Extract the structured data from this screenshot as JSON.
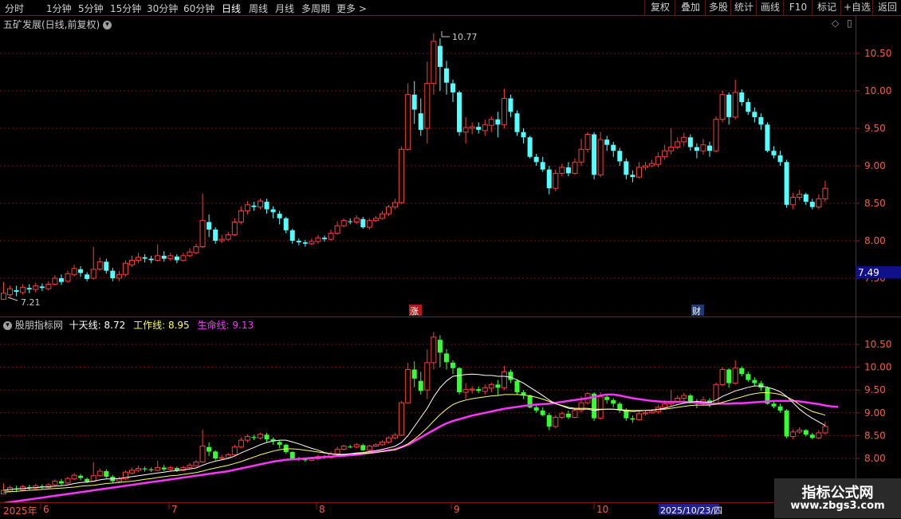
{
  "toolbar": {
    "timeframes": [
      "分时",
      "1分钟",
      "5分钟",
      "15分钟",
      "30分钟",
      "60分钟",
      "日线",
      "周线",
      "月线",
      "多周期",
      "更多"
    ],
    "active_timeframe": "日线",
    "more_arrow": ">",
    "buttons": [
      "复权",
      "叠加",
      "多股",
      "统计",
      "画线",
      "F10",
      "标记",
      "+自选",
      "返回"
    ]
  },
  "main_chart": {
    "title": "五矿发展(日线,前复权)",
    "right_icons": [
      "◇",
      "▯"
    ],
    "price_labels": [
      "10.50",
      "10.00",
      "9.50",
      "9.00",
      "8.50",
      "8.00",
      "7.50"
    ],
    "high_marker": "10.77",
    "low_marker": "7.21",
    "current_price_label": "7.49",
    "markers": [
      "涨",
      "财"
    ]
  },
  "sub_chart": {
    "title": "股朋指标网",
    "line1_label": "十天线:",
    "line1_value": "8.72",
    "line2_label": "工作线:",
    "line2_value": "8.95",
    "line3_label": "生命线:",
    "line3_value": "9.13",
    "price_labels": [
      "10.50",
      "10.00",
      "9.50",
      "9.00",
      "8.50",
      "8.00"
    ]
  },
  "time_axis": {
    "labels": [
      "2025年",
      "6",
      "7",
      "8",
      "9",
      "10"
    ],
    "highlighted_date": "2025/10/23/四"
  },
  "watermark": {
    "line1": "指标公式网",
    "line2": "www.zbgs3.com"
  },
  "colors": {
    "up": "#ff3b3b",
    "down_main": "#54ffff",
    "down_sub": "#33ff33",
    "ten_line": "#ffffff",
    "work_line": "#ffff66",
    "life_line": "#ff33ff",
    "grid": "#7a1010"
  },
  "chart_data": {
    "type": "candlestick",
    "candles": [
      [
        7.22,
        7.3,
        7.45,
        7.21
      ],
      [
        7.28,
        7.36,
        7.4,
        7.25
      ],
      [
        7.34,
        7.32,
        7.4,
        7.26
      ],
      [
        7.31,
        7.38,
        7.42,
        7.28
      ],
      [
        7.37,
        7.35,
        7.42,
        7.3
      ],
      [
        7.35,
        7.4,
        7.44,
        7.31
      ],
      [
        7.39,
        7.37,
        7.43,
        7.33
      ],
      [
        7.36,
        7.42,
        7.46,
        7.34
      ],
      [
        7.42,
        7.5,
        7.54,
        7.4
      ],
      [
        7.5,
        7.45,
        7.55,
        7.41
      ],
      [
        7.46,
        7.56,
        7.6,
        7.44
      ],
      [
        7.55,
        7.63,
        7.68,
        7.52
      ],
      [
        7.62,
        7.57,
        7.66,
        7.52
      ],
      [
        7.55,
        7.49,
        7.58,
        7.46
      ],
      [
        7.5,
        7.62,
        7.92,
        7.48
      ],
      [
        7.62,
        7.72,
        7.78,
        7.6
      ],
      [
        7.72,
        7.6,
        7.76,
        7.56
      ],
      [
        7.6,
        7.5,
        7.64,
        7.46
      ],
      [
        7.5,
        7.55,
        7.6,
        7.46
      ],
      [
        7.55,
        7.7,
        7.74,
        7.52
      ],
      [
        7.68,
        7.74,
        7.8,
        7.65
      ],
      [
        7.74,
        7.78,
        7.84,
        7.7
      ],
      [
        7.78,
        7.76,
        7.82,
        7.71
      ],
      [
        7.76,
        7.74,
        7.8,
        7.7
      ],
      [
        7.74,
        7.8,
        7.95,
        7.72
      ],
      [
        7.8,
        7.76,
        7.86,
        7.72
      ],
      [
        7.76,
        7.8,
        7.84,
        7.73
      ],
      [
        7.79,
        7.74,
        7.82,
        7.7
      ],
      [
        7.74,
        7.8,
        7.84,
        7.72
      ],
      [
        7.8,
        7.85,
        7.9,
        7.78
      ],
      [
        7.84,
        7.92,
        7.96,
        7.82
      ],
      [
        7.92,
        8.27,
        8.63,
        7.9
      ],
      [
        8.25,
        8.15,
        8.35,
        8.05
      ],
      [
        8.15,
        8.0,
        8.18,
        7.96
      ],
      [
        8.0,
        8.02,
        8.08,
        7.97
      ],
      [
        8.02,
        8.08,
        8.12,
        8.0
      ],
      [
        8.08,
        8.25,
        8.3,
        8.06
      ],
      [
        8.25,
        8.4,
        8.46,
        8.22
      ],
      [
        8.4,
        8.48,
        8.53,
        8.35
      ],
      [
        8.47,
        8.45,
        8.52,
        8.4
      ],
      [
        8.45,
        8.53,
        8.56,
        8.42
      ],
      [
        8.52,
        8.42,
        8.56,
        8.36
      ],
      [
        8.42,
        8.38,
        8.46,
        8.3
      ],
      [
        8.36,
        8.3,
        8.4,
        8.22
      ],
      [
        8.3,
        8.14,
        8.32,
        8.1
      ],
      [
        8.14,
        8.0,
        8.16,
        7.96
      ],
      [
        8.0,
        7.98,
        8.03,
        7.94
      ],
      [
        7.98,
        7.96,
        8.01,
        7.92
      ],
      [
        7.96,
        7.99,
        8.03,
        7.94
      ],
      [
        7.99,
        8.04,
        8.08,
        7.96
      ],
      [
        8.04,
        8.02,
        8.07,
        7.99
      ],
      [
        8.02,
        8.1,
        8.15,
        8.0
      ],
      [
        8.1,
        8.2,
        8.26,
        8.08
      ],
      [
        8.2,
        8.27,
        8.3,
        8.18
      ],
      [
        8.26,
        8.25,
        8.3,
        8.22
      ],
      [
        8.25,
        8.3,
        8.34,
        8.22
      ],
      [
        8.29,
        8.18,
        8.32,
        8.16
      ],
      [
        8.18,
        8.27,
        8.3,
        8.15
      ],
      [
        8.27,
        8.3,
        8.33,
        8.25
      ],
      [
        8.3,
        8.36,
        8.4,
        8.28
      ],
      [
        8.36,
        8.45,
        8.48,
        8.33
      ],
      [
        8.45,
        8.51,
        8.56,
        8.42
      ],
      [
        8.51,
        9.22,
        9.26,
        8.49
      ],
      [
        9.22,
        9.95,
        10.1,
        9.2
      ],
      [
        9.95,
        9.75,
        10.13,
        9.56
      ],
      [
        9.7,
        9.48,
        9.9,
        9.4
      ],
      [
        9.5,
        10.1,
        10.39,
        9.3
      ],
      [
        10.1,
        10.66,
        10.77,
        9.95
      ],
      [
        10.6,
        10.32,
        10.7,
        10.0
      ],
      [
        10.3,
        10.11,
        10.4,
        9.95
      ],
      [
        10.1,
        9.98,
        10.15,
        9.85
      ],
      [
        9.98,
        9.45,
        10.0,
        9.4
      ],
      [
        9.45,
        9.51,
        9.65,
        9.3
      ],
      [
        9.5,
        9.52,
        9.58,
        9.42
      ],
      [
        9.52,
        9.48,
        9.58,
        9.43
      ],
      [
        9.47,
        9.55,
        9.62,
        9.4
      ],
      [
        9.54,
        9.62,
        9.66,
        9.45
      ],
      [
        9.62,
        9.55,
        9.72,
        9.38
      ],
      [
        9.55,
        9.9,
        10.03,
        9.5
      ],
      [
        9.9,
        9.72,
        9.95,
        9.65
      ],
      [
        9.7,
        9.45,
        9.74,
        9.4
      ],
      [
        9.45,
        9.38,
        9.5,
        9.3
      ],
      [
        9.38,
        9.12,
        9.4,
        9.1
      ],
      [
        9.12,
        9.05,
        9.16,
        9.0
      ],
      [
        9.05,
        8.95,
        9.12,
        8.92
      ],
      [
        8.95,
        8.7,
        9.0,
        8.62
      ],
      [
        8.7,
        8.9,
        8.95,
        8.66
      ],
      [
        8.9,
        8.98,
        9.03,
        8.86
      ],
      [
        8.98,
        8.9,
        9.05,
        8.86
      ],
      [
        8.9,
        9.05,
        9.1,
        8.88
      ],
      [
        9.05,
        9.22,
        9.36,
        9.0
      ],
      [
        9.22,
        9.42,
        9.45,
        9.18
      ],
      [
        9.42,
        8.88,
        9.45,
        8.82
      ],
      [
        8.88,
        9.35,
        9.45,
        8.85
      ],
      [
        9.35,
        9.28,
        9.4,
        9.2
      ],
      [
        9.28,
        9.2,
        9.32,
        9.12
      ],
      [
        9.2,
        9.06,
        9.24,
        9.0
      ],
      [
        9.06,
        8.88,
        9.1,
        8.82
      ],
      [
        8.88,
        8.85,
        8.94,
        8.78
      ],
      [
        8.85,
        8.98,
        9.05,
        8.83
      ],
      [
        8.98,
        9.0,
        9.05,
        8.94
      ],
      [
        9.0,
        9.03,
        9.08,
        8.98
      ],
      [
        9.02,
        9.12,
        9.18,
        8.98
      ],
      [
        9.12,
        9.2,
        9.28,
        9.08
      ],
      [
        9.2,
        9.25,
        9.5,
        9.15
      ],
      [
        9.25,
        9.32,
        9.38,
        9.22
      ],
      [
        9.32,
        9.38,
        9.44,
        9.26
      ],
      [
        9.38,
        9.25,
        9.42,
        9.2
      ],
      [
        9.25,
        9.2,
        9.3,
        9.1
      ],
      [
        9.2,
        9.28,
        9.36,
        9.15
      ],
      [
        9.27,
        9.2,
        9.32,
        9.12
      ],
      [
        9.2,
        9.62,
        9.66,
        9.18
      ],
      [
        9.62,
        9.95,
        10.0,
        9.58
      ],
      [
        9.95,
        9.65,
        9.98,
        9.55
      ],
      [
        9.65,
        9.98,
        10.15,
        9.62
      ],
      [
        9.98,
        9.85,
        10.02,
        9.8
      ],
      [
        9.85,
        9.72,
        9.9,
        9.68
      ],
      [
        9.72,
        9.65,
        9.78,
        9.58
      ],
      [
        9.65,
        9.55,
        9.7,
        9.48
      ],
      [
        9.55,
        9.2,
        9.58,
        9.18
      ],
      [
        9.2,
        9.14,
        9.26,
        9.1
      ],
      [
        9.14,
        9.05,
        9.2,
        9.0
      ],
      [
        9.05,
        8.48,
        9.08,
        8.44
      ],
      [
        8.48,
        8.58,
        8.64,
        8.42
      ],
      [
        8.58,
        8.62,
        8.68,
        8.54
      ],
      [
        8.62,
        8.52,
        8.64,
        8.48
      ],
      [
        8.52,
        8.45,
        8.56,
        8.42
      ],
      [
        8.45,
        8.56,
        8.62,
        8.42
      ],
      [
        8.56,
        8.7,
        8.8,
        8.52
      ]
    ],
    "ten_line": [
      7.3,
      7.32,
      7.33,
      7.34,
      7.35,
      7.36,
      7.37,
      7.38,
      7.39,
      7.4,
      7.42,
      7.45,
      7.47,
      7.48,
      7.5,
      7.53,
      7.55,
      7.55,
      7.56,
      7.58,
      7.6,
      7.62,
      7.64,
      7.66,
      7.68,
      7.7,
      7.72,
      7.73,
      7.75,
      7.77,
      7.79,
      7.85,
      7.9,
      7.94,
      7.97,
      8.0,
      8.05,
      8.12,
      8.18,
      8.24,
      8.3,
      8.35,
      8.38,
      8.4,
      8.4,
      8.36,
      8.32,
      8.27,
      8.22,
      8.18,
      8.13,
      8.1,
      8.08,
      8.08,
      8.1,
      8.12,
      8.13,
      8.15,
      8.17,
      8.2,
      8.23,
      8.27,
      8.35,
      8.5,
      8.7,
      8.9,
      9.1,
      9.35,
      9.55,
      9.7,
      9.8,
      9.82,
      9.84,
      9.85,
      9.84,
      9.82,
      9.82,
      9.8,
      9.8,
      9.78,
      9.72,
      9.65,
      9.56,
      9.47,
      9.38,
      9.28,
      9.2,
      9.15,
      9.1,
      9.08,
      9.08,
      9.08,
      9.05,
      9.07,
      9.08,
      9.08,
      9.06,
      9.04,
      9.03,
      9.04,
      9.05,
      9.06,
      9.08,
      9.1,
      9.14,
      9.18,
      9.21,
      9.24,
      9.25,
      9.24,
      9.23,
      9.28,
      9.36,
      9.42,
      9.48,
      9.52,
      9.56,
      9.59,
      9.59,
      9.56,
      9.52,
      9.46,
      9.36,
      9.22,
      9.08,
      8.97,
      8.88,
      8.8,
      8.72
    ],
    "work_line": [
      7.26,
      7.27,
      7.28,
      7.29,
      7.3,
      7.31,
      7.32,
      7.33,
      7.34,
      7.35,
      7.36,
      7.37,
      7.39,
      7.4,
      7.41,
      7.43,
      7.45,
      7.46,
      7.47,
      7.49,
      7.5,
      7.52,
      7.54,
      7.56,
      7.58,
      7.6,
      7.62,
      7.63,
      7.65,
      7.67,
      7.69,
      7.72,
      7.76,
      7.79,
      7.82,
      7.85,
      7.89,
      7.93,
      7.98,
      8.03,
      8.08,
      8.12,
      8.16,
      8.19,
      8.21,
      8.21,
      8.2,
      8.18,
      8.16,
      8.14,
      8.12,
      8.1,
      8.09,
      8.09,
      8.1,
      8.1,
      8.11,
      8.12,
      8.13,
      8.15,
      8.17,
      8.19,
      8.24,
      8.32,
      8.42,
      8.54,
      8.67,
      8.82,
      8.96,
      9.08,
      9.18,
      9.24,
      9.28,
      9.31,
      9.33,
      9.35,
      9.37,
      9.38,
      9.4,
      9.4,
      9.4,
      9.39,
      9.37,
      9.34,
      9.3,
      9.25,
      9.2,
      9.16,
      9.12,
      9.1,
      9.1,
      9.1,
      9.08,
      9.08,
      9.08,
      9.08,
      9.07,
      9.06,
      9.05,
      9.05,
      9.05,
      9.06,
      9.07,
      9.08,
      9.1,
      9.12,
      9.14,
      9.16,
      9.17,
      9.17,
      9.17,
      9.19,
      9.23,
      9.27,
      9.31,
      9.35,
      9.39,
      9.42,
      9.44,
      9.44,
      9.43,
      9.4,
      9.35,
      9.28,
      9.18,
      9.1,
      9.03,
      8.99,
      8.95
    ],
    "life_line": [
      7.02,
      7.04,
      7.06,
      7.08,
      7.1,
      7.12,
      7.14,
      7.16,
      7.18,
      7.2,
      7.22,
      7.24,
      7.26,
      7.28,
      7.3,
      7.32,
      7.34,
      7.36,
      7.38,
      7.4,
      7.42,
      7.44,
      7.46,
      7.48,
      7.5,
      7.52,
      7.54,
      7.56,
      7.58,
      7.6,
      7.62,
      7.64,
      7.66,
      7.68,
      7.7,
      7.72,
      7.75,
      7.78,
      7.81,
      7.84,
      7.87,
      7.9,
      7.93,
      7.95,
      7.97,
      7.98,
      7.99,
      8.0,
      8.01,
      8.02,
      8.03,
      8.04,
      8.05,
      8.06,
      8.07,
      8.08,
      8.1,
      8.12,
      8.14,
      8.16,
      8.18,
      8.2,
      8.25,
      8.3,
      8.38,
      8.46,
      8.54,
      8.62,
      8.7,
      8.77,
      8.82,
      8.86,
      8.9,
      8.94,
      8.97,
      9.0,
      9.03,
      9.06,
      9.09,
      9.11,
      9.13,
      9.15,
      9.17,
      9.18,
      9.19,
      9.2,
      9.22,
      9.24,
      9.26,
      9.28,
      9.3,
      9.32,
      9.35,
      9.38,
      9.4,
      9.4,
      9.38,
      9.35,
      9.32,
      9.3,
      9.28,
      9.26,
      9.25,
      9.24,
      9.24,
      9.24,
      9.24,
      9.23,
      9.22,
      9.21,
      9.2,
      9.2,
      9.2,
      9.2,
      9.21,
      9.21,
      9.22,
      9.23,
      9.24,
      9.25,
      9.26,
      9.26,
      9.26,
      9.26,
      9.25,
      9.23,
      9.21,
      9.19,
      9.16,
      9.14,
      9.13
    ]
  }
}
